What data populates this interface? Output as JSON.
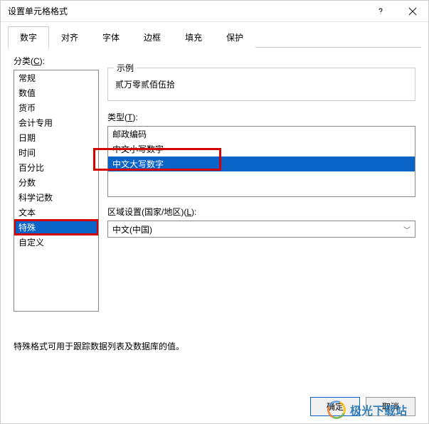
{
  "titlebar": {
    "title": "设置单元格格式"
  },
  "tabs": [
    {
      "label": "数字",
      "active": true
    },
    {
      "label": "对齐",
      "active": false
    },
    {
      "label": "字体",
      "active": false
    },
    {
      "label": "边框",
      "active": false
    },
    {
      "label": "填充",
      "active": false
    },
    {
      "label": "保护",
      "active": false
    }
  ],
  "category": {
    "label_pre": "分类(",
    "label_u": "C",
    "label_post": "):",
    "items": [
      {
        "label": "常规"
      },
      {
        "label": "数值"
      },
      {
        "label": "货币"
      },
      {
        "label": "会计专用"
      },
      {
        "label": "日期"
      },
      {
        "label": "时间"
      },
      {
        "label": "百分比"
      },
      {
        "label": "分数"
      },
      {
        "label": "科学记数"
      },
      {
        "label": "文本"
      },
      {
        "label": "特殊",
        "selected": true,
        "highlighted": true
      },
      {
        "label": "自定义"
      }
    ]
  },
  "sample": {
    "title": "示例",
    "value": "贰万零贰佰伍拾"
  },
  "type": {
    "label_pre": "类型(",
    "label_u": "T",
    "label_post": "):",
    "items": [
      {
        "label": "邮政编码"
      },
      {
        "label": "中文小写数字"
      },
      {
        "label": "中文大写数字",
        "selected": true,
        "highlighted": true
      }
    ]
  },
  "locale": {
    "label_pre": "区域设置(国家/地区)(",
    "label_u": "L",
    "label_post": "):",
    "value": "中文(中国)"
  },
  "hint": "特殊格式可用于跟踪数据列表及数据库的值。",
  "buttons": {
    "ok": "确定",
    "cancel": "取消"
  },
  "watermark": "极光下载站"
}
